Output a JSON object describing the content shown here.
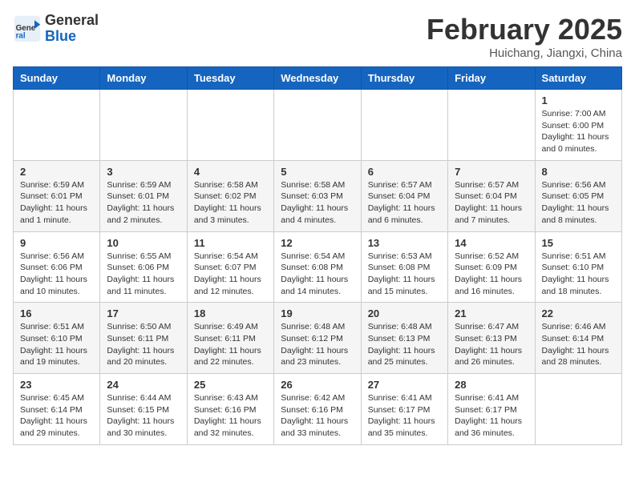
{
  "header": {
    "logo_general": "General",
    "logo_blue": "Blue",
    "month_title": "February 2025",
    "location": "Huichang, Jiangxi, China"
  },
  "days_of_week": [
    "Sunday",
    "Monday",
    "Tuesday",
    "Wednesday",
    "Thursday",
    "Friday",
    "Saturday"
  ],
  "weeks": [
    [
      {
        "day": "",
        "info": ""
      },
      {
        "day": "",
        "info": ""
      },
      {
        "day": "",
        "info": ""
      },
      {
        "day": "",
        "info": ""
      },
      {
        "day": "",
        "info": ""
      },
      {
        "day": "",
        "info": ""
      },
      {
        "day": "1",
        "info": "Sunrise: 7:00 AM\nSunset: 6:00 PM\nDaylight: 11 hours\nand 0 minutes."
      }
    ],
    [
      {
        "day": "2",
        "info": "Sunrise: 6:59 AM\nSunset: 6:01 PM\nDaylight: 11 hours\nand 1 minute."
      },
      {
        "day": "3",
        "info": "Sunrise: 6:59 AM\nSunset: 6:01 PM\nDaylight: 11 hours\nand 2 minutes."
      },
      {
        "day": "4",
        "info": "Sunrise: 6:58 AM\nSunset: 6:02 PM\nDaylight: 11 hours\nand 3 minutes."
      },
      {
        "day": "5",
        "info": "Sunrise: 6:58 AM\nSunset: 6:03 PM\nDaylight: 11 hours\nand 4 minutes."
      },
      {
        "day": "6",
        "info": "Sunrise: 6:57 AM\nSunset: 6:04 PM\nDaylight: 11 hours\nand 6 minutes."
      },
      {
        "day": "7",
        "info": "Sunrise: 6:57 AM\nSunset: 6:04 PM\nDaylight: 11 hours\nand 7 minutes."
      },
      {
        "day": "8",
        "info": "Sunrise: 6:56 AM\nSunset: 6:05 PM\nDaylight: 11 hours\nand 8 minutes."
      }
    ],
    [
      {
        "day": "9",
        "info": "Sunrise: 6:56 AM\nSunset: 6:06 PM\nDaylight: 11 hours\nand 10 minutes."
      },
      {
        "day": "10",
        "info": "Sunrise: 6:55 AM\nSunset: 6:06 PM\nDaylight: 11 hours\nand 11 minutes."
      },
      {
        "day": "11",
        "info": "Sunrise: 6:54 AM\nSunset: 6:07 PM\nDaylight: 11 hours\nand 12 minutes."
      },
      {
        "day": "12",
        "info": "Sunrise: 6:54 AM\nSunset: 6:08 PM\nDaylight: 11 hours\nand 14 minutes."
      },
      {
        "day": "13",
        "info": "Sunrise: 6:53 AM\nSunset: 6:08 PM\nDaylight: 11 hours\nand 15 minutes."
      },
      {
        "day": "14",
        "info": "Sunrise: 6:52 AM\nSunset: 6:09 PM\nDaylight: 11 hours\nand 16 minutes."
      },
      {
        "day": "15",
        "info": "Sunrise: 6:51 AM\nSunset: 6:10 PM\nDaylight: 11 hours\nand 18 minutes."
      }
    ],
    [
      {
        "day": "16",
        "info": "Sunrise: 6:51 AM\nSunset: 6:10 PM\nDaylight: 11 hours\nand 19 minutes."
      },
      {
        "day": "17",
        "info": "Sunrise: 6:50 AM\nSunset: 6:11 PM\nDaylight: 11 hours\nand 20 minutes."
      },
      {
        "day": "18",
        "info": "Sunrise: 6:49 AM\nSunset: 6:11 PM\nDaylight: 11 hours\nand 22 minutes."
      },
      {
        "day": "19",
        "info": "Sunrise: 6:48 AM\nSunset: 6:12 PM\nDaylight: 11 hours\nand 23 minutes."
      },
      {
        "day": "20",
        "info": "Sunrise: 6:48 AM\nSunset: 6:13 PM\nDaylight: 11 hours\nand 25 minutes."
      },
      {
        "day": "21",
        "info": "Sunrise: 6:47 AM\nSunset: 6:13 PM\nDaylight: 11 hours\nand 26 minutes."
      },
      {
        "day": "22",
        "info": "Sunrise: 6:46 AM\nSunset: 6:14 PM\nDaylight: 11 hours\nand 28 minutes."
      }
    ],
    [
      {
        "day": "23",
        "info": "Sunrise: 6:45 AM\nSunset: 6:14 PM\nDaylight: 11 hours\nand 29 minutes."
      },
      {
        "day": "24",
        "info": "Sunrise: 6:44 AM\nSunset: 6:15 PM\nDaylight: 11 hours\nand 30 minutes."
      },
      {
        "day": "25",
        "info": "Sunrise: 6:43 AM\nSunset: 6:16 PM\nDaylight: 11 hours\nand 32 minutes."
      },
      {
        "day": "26",
        "info": "Sunrise: 6:42 AM\nSunset: 6:16 PM\nDaylight: 11 hours\nand 33 minutes."
      },
      {
        "day": "27",
        "info": "Sunrise: 6:41 AM\nSunset: 6:17 PM\nDaylight: 11 hours\nand 35 minutes."
      },
      {
        "day": "28",
        "info": "Sunrise: 6:41 AM\nSunset: 6:17 PM\nDaylight: 11 hours\nand 36 minutes."
      },
      {
        "day": "",
        "info": ""
      }
    ]
  ]
}
